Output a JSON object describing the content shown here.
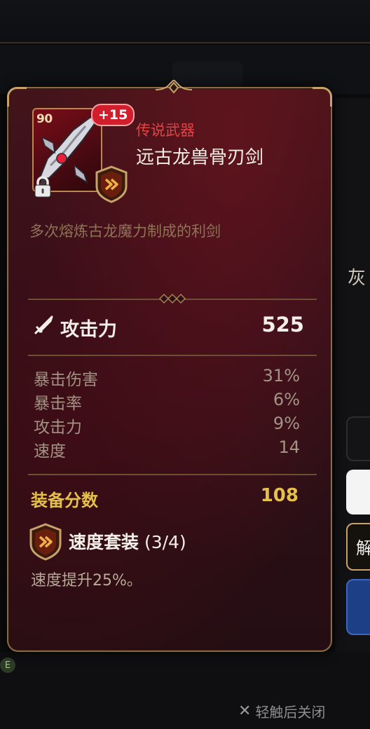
{
  "item": {
    "level": "90",
    "enhance": "+15",
    "rarity": "传说武器",
    "name": "远古龙兽骨刃剑",
    "description": "多次熔炼古龙魔力制成的利剑"
  },
  "main_stat": {
    "label": "攻击力",
    "value": "525",
    "icon": "sword-icon"
  },
  "sub_stats": [
    {
      "label": "暴击伤害",
      "value": "31%"
    },
    {
      "label": "暴击率",
      "value": "6%"
    },
    {
      "label": "攻击力",
      "value": "9%"
    },
    {
      "label": "速度",
      "value": "14"
    }
  ],
  "score": {
    "label": "装备分数",
    "value": "108"
  },
  "set": {
    "name": "速度套装",
    "count": "(3/4)",
    "description": "速度提升25%。",
    "icon": "speed-set-icon"
  },
  "background": {
    "right_text": "灰",
    "right_button_text": "解",
    "badge": "E"
  },
  "close_hint": "轻触后关闭",
  "colors": {
    "rarity": "#e24444",
    "score": "#e6c14a",
    "card_border": "#8d6a44",
    "card_bg": "#33101a"
  }
}
